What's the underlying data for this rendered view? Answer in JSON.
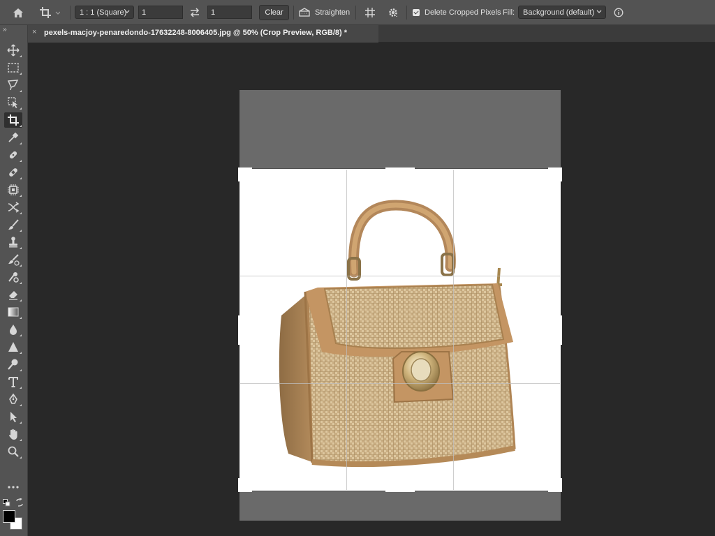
{
  "options_bar": {
    "ratio_preset": "1 : 1 (Square)",
    "width_value": "1",
    "height_value": "1",
    "clear_label": "Clear",
    "straighten_label": "Straighten",
    "delete_cropped_label": "Delete Cropped Pixels",
    "delete_cropped_checked": true,
    "fill_label": "Fill:",
    "fill_value": "Background (default)"
  },
  "document_tab": {
    "title": "pexels-macjoy-penaredondo-17632248-8006405.jpg @ 50% (Crop Preview, RGB/8) *",
    "close_glyph": "×"
  },
  "toolbar": {
    "collapse_glyph": "››",
    "tools": [
      {
        "name": "move-tool",
        "icon": "move-icon"
      },
      {
        "name": "marquee-tool",
        "icon": "rect-marquee-icon"
      },
      {
        "name": "lasso-tool",
        "icon": "lasso-icon"
      },
      {
        "name": "object-select-tool",
        "icon": "object-select-icon"
      },
      {
        "name": "crop-tool",
        "icon": "crop-icon",
        "active": true
      },
      {
        "name": "eyedropper-tool",
        "icon": "eyedropper-icon"
      },
      {
        "name": "spot-healing-tool",
        "icon": "healing-icon"
      },
      {
        "name": "healing-brush-tool",
        "icon": "bandage-icon"
      },
      {
        "name": "content-aware-tool",
        "icon": "chip-icon"
      },
      {
        "name": "red-eye-tool",
        "icon": "cross-arrows-icon"
      },
      {
        "name": "brush-tool",
        "icon": "brush-icon"
      },
      {
        "name": "clone-stamp-tool",
        "icon": "stamp-icon"
      },
      {
        "name": "history-brush-tool",
        "icon": "history-brush-icon"
      },
      {
        "name": "pattern-stamp-tool",
        "icon": "pattern-icon"
      },
      {
        "name": "eraser-tool",
        "icon": "eraser-icon"
      },
      {
        "name": "gradient-tool",
        "icon": "gradient-icon"
      },
      {
        "name": "blur-tool",
        "icon": "drop-icon"
      },
      {
        "name": "sharpen-tool",
        "icon": "triangle-icon"
      },
      {
        "name": "dodge-tool",
        "icon": "dodge-icon"
      },
      {
        "name": "type-tool",
        "icon": "type-icon"
      },
      {
        "name": "pen-tool",
        "icon": "pen-icon"
      },
      {
        "name": "path-select-tool",
        "icon": "arrow-select-icon"
      },
      {
        "name": "hand-tool",
        "icon": "hand-icon"
      },
      {
        "name": "zoom-tool",
        "icon": "zoom-icon"
      },
      {
        "name": "more-tools",
        "icon": "ellipsis-icon"
      }
    ],
    "foreground_color": "#000000",
    "background_color": "#ffffff"
  },
  "colors": {
    "app_bg": "#282828",
    "panel": "#535353",
    "accent_bag": "#c79a62"
  }
}
